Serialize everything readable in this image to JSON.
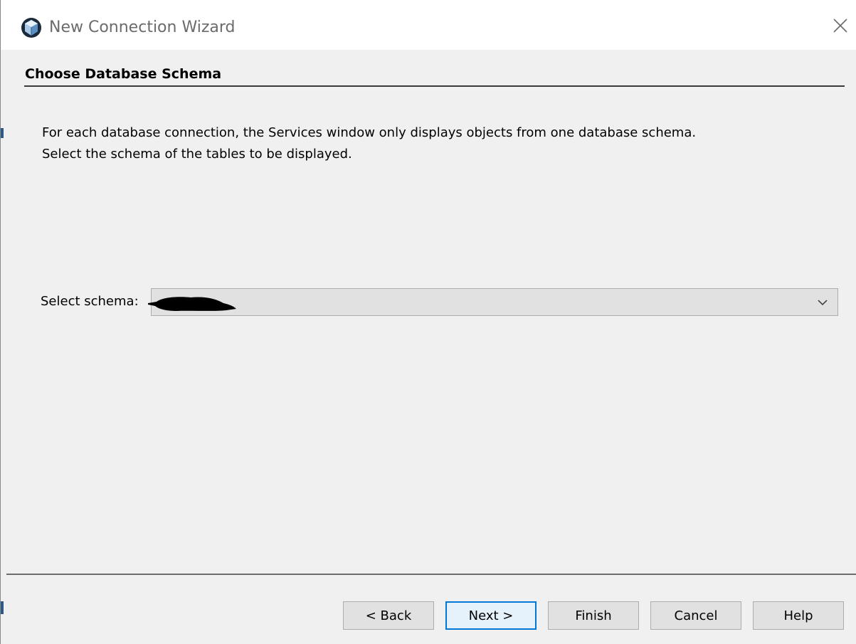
{
  "window": {
    "title": "New Connection Wizard",
    "icon": "netbeans-cube-icon",
    "close_icon": "close-icon"
  },
  "step": {
    "title": "Choose Database Schema",
    "description_lines": [
      "For each database connection, the Services window only displays objects from one database schema.",
      "Select the schema of the tables to be displayed."
    ]
  },
  "schema": {
    "label": "Select schema:",
    "selected_value": "",
    "value_redacted": true,
    "dropdown_icon": "chevron-down-icon"
  },
  "buttons": {
    "back": "< Back",
    "next": "Next >",
    "finish": "Finish",
    "cancel": "Cancel",
    "help": "Help",
    "default": "next"
  },
  "colors": {
    "titlebar_bg": "#ffffff",
    "dialog_bg": "#f0f0f0",
    "button_bg": "#e1e1e1",
    "default_button_border": "#0078d7",
    "default_button_bg": "#e5f1fb"
  }
}
